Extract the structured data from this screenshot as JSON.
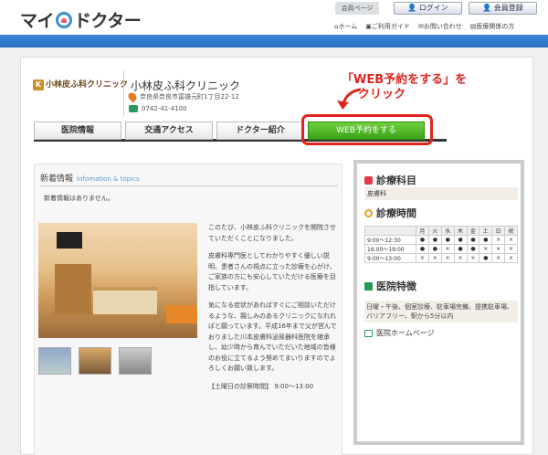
{
  "site": {
    "logo_text": "マイ",
    "logo_text2": "ドクター",
    "member_tab": "会員ページ",
    "login": "ログイン",
    "register": "会員登録",
    "nav": [
      "ホーム",
      "ご利用ガイド",
      "お問い合わせ",
      "医療関係の方"
    ]
  },
  "clinic": {
    "logo": "小林皮ふ科クリニック",
    "name": "小林皮ふ科クリニック",
    "address": "奈良県奈良市富雄元町1丁目22-12",
    "tel": "0742-41-4100"
  },
  "tabs": [
    "医院情報",
    "交通アクセス",
    "ドクター紹介",
    "WEB予約をする"
  ],
  "callout": {
    "line1": "「WEB予約をする」を",
    "line2": "クリック"
  },
  "news": {
    "title": "新着情報",
    "title_en": "Infomation & topics",
    "empty": "新着情報はありません。"
  },
  "intro": {
    "p1": "このたび、小林皮ふ科クリニックを開院させていただくことになりました。",
    "p2": "皮膚科専門医としてわかりやすく優しい説明、患者さんの視点に立った診療を心がけ、ご家族の方にも安心していただける医療を目指しています。",
    "p3": "気になる症状があればすぐにご相談いただけるような、親しみのあるクリニックになれればと願っています。平成16年まで父が営んでおりました川本皮膚科泌尿器科医院を継承し、幼少時から育んでいただいた地域の皆様のお役に立てるよう努めてまいりますのでよろしくお願い致します。",
    "p4": "【土曜日の診察時間】 9:00～13:00"
  },
  "sidebar": {
    "dept_title": "診療科目",
    "dept_value": "皮膚科",
    "hours_title": "診療時間",
    "days": [
      "月",
      "火",
      "水",
      "木",
      "金",
      "土",
      "日",
      "祝"
    ],
    "rows": [
      {
        "time": "9:00～12:30",
        "marks": [
          "●",
          "●",
          "●",
          "●",
          "●",
          "●",
          "×",
          "×"
        ]
      },
      {
        "time": "16:00～19:00",
        "marks": [
          "●",
          "●",
          "×",
          "●",
          "●",
          "×",
          "×",
          "×"
        ]
      },
      {
        "time": "9:00～13:00",
        "marks": [
          "×",
          "×",
          "×",
          "×",
          "×",
          "●",
          "×",
          "×"
        ]
      }
    ],
    "features_title": "医院特徴",
    "features": "日曜・午後、個室診療、駐車場完備、提携駐車場、バリアフリー、駅から5分以内",
    "homepage": "医院ホームページ"
  }
}
